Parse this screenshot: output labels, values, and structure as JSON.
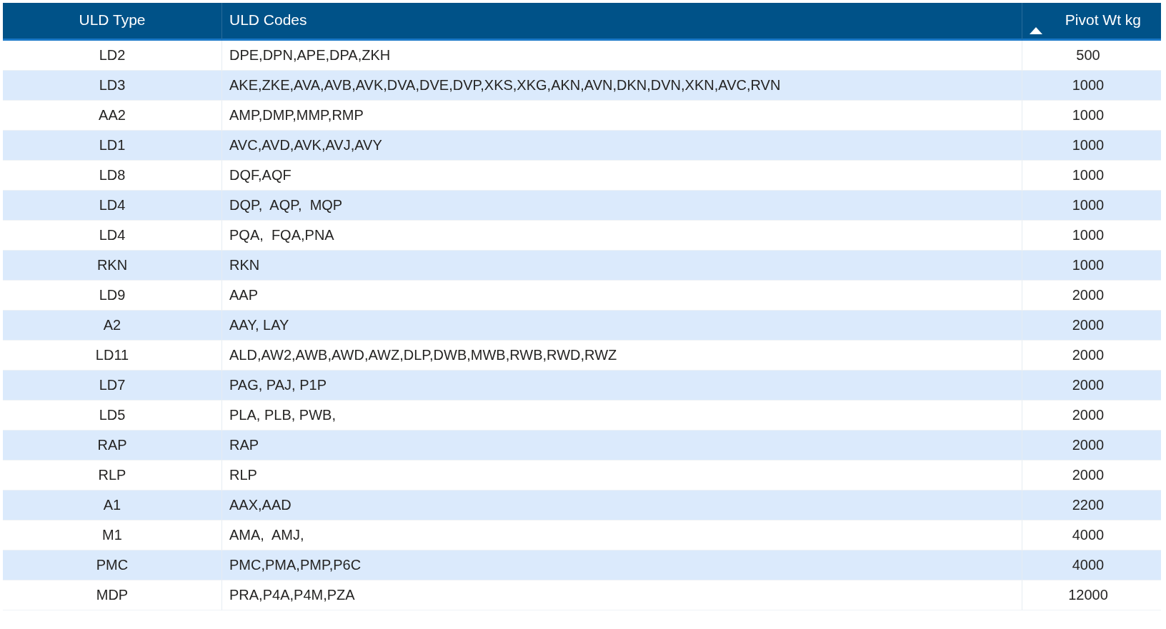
{
  "table": {
    "columns": [
      {
        "label": "ULD Type",
        "sorted": false
      },
      {
        "label": "ULD Codes",
        "sorted": false
      },
      {
        "label": "Pivot Wt kg",
        "sorted": true
      }
    ],
    "rows": [
      [
        "LD2",
        "DPE,DPN,APE,DPA,ZKH",
        "500"
      ],
      [
        "LD3",
        "AKE,ZKE,AVA,AVB,AVK,DVA,DVE,DVP,XKS,XKG,AKN,AVN,DKN,DVN,XKN,AVC,RVN",
        "1000"
      ],
      [
        "AA2",
        "AMP,DMP,MMP,RMP",
        "1000"
      ],
      [
        "LD1",
        "AVC,AVD,AVK,AVJ,AVY",
        "1000"
      ],
      [
        "LD8",
        "DQF,AQF",
        "1000"
      ],
      [
        "LD4",
        "DQP,  AQP,  MQP",
        "1000"
      ],
      [
        "LD4",
        "PQA,  FQA,PNA",
        "1000"
      ],
      [
        "RKN",
        "RKN",
        "1000"
      ],
      [
        "LD9",
        "AAP",
        "2000"
      ],
      [
        "A2",
        "AAY, LAY",
        "2000"
      ],
      [
        "LD11",
        "ALD,AW2,AWB,AWD,AWZ,DLP,DWB,MWB,RWB,RWD,RWZ",
        "2000"
      ],
      [
        "LD7",
        "PAG, PAJ, P1P",
        "2000"
      ],
      [
        "LD5",
        "PLA, PLB, PWB,",
        "2000"
      ],
      [
        "RAP",
        "RAP",
        "2000"
      ],
      [
        "RLP",
        "RLP",
        "2000"
      ],
      [
        "A1",
        "AAX,AAD",
        "2200"
      ],
      [
        "M1",
        "AMA,  AMJ,",
        "4000"
      ],
      [
        "PMC",
        "PMC,PMA,PMP,P6C",
        "4000"
      ],
      [
        "MDP",
        "PRA,P4A,P4M,PZA",
        "12000"
      ]
    ]
  }
}
